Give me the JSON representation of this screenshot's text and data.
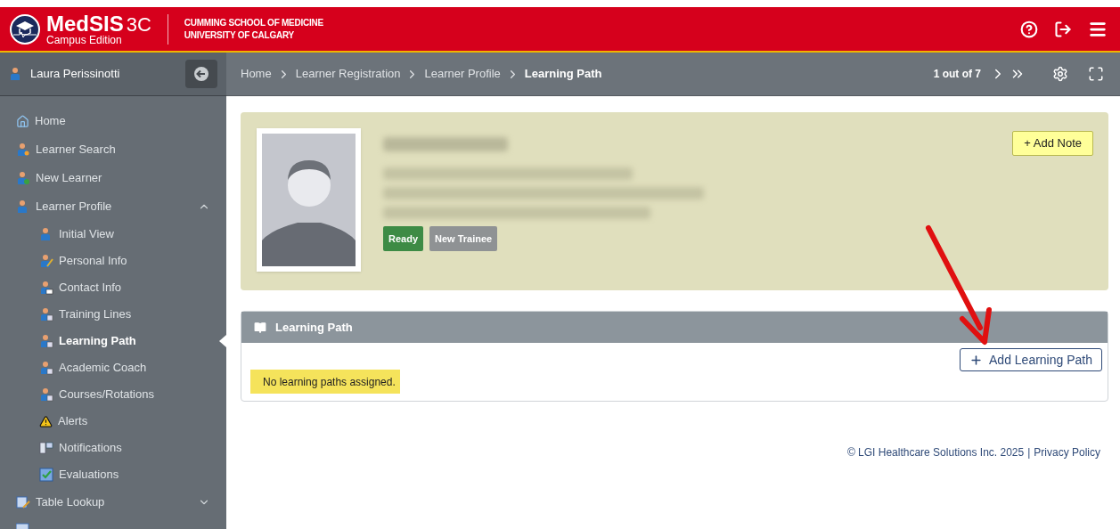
{
  "header": {
    "logo_title": "MedSIS",
    "logo_version": "3C",
    "logo_subtitle": "Campus Edition",
    "school_line_1": "CUMMING SCHOOL OF MEDICINE",
    "school_line_2": "UNIVERSITY OF CALGARY"
  },
  "user": {
    "name": "Laura Perissinotti"
  },
  "breadcrumb": [
    {
      "label": "Home",
      "current": false
    },
    {
      "label": "Learner Registration",
      "current": false
    },
    {
      "label": "Learner Profile",
      "current": false
    },
    {
      "label": "Learning Path",
      "current": true
    }
  ],
  "pager": {
    "text": "1 out of 7"
  },
  "sidebar": {
    "items": [
      {
        "label": "Home",
        "selected": false
      },
      {
        "label": "Learner Search",
        "selected": false
      },
      {
        "label": "New Learner",
        "selected": false
      },
      {
        "label": "Learner Profile",
        "selected": false,
        "expanded": true,
        "children": [
          {
            "label": "Initial View",
            "selected": false
          },
          {
            "label": "Personal Info",
            "selected": false
          },
          {
            "label": "Contact Info",
            "selected": false
          },
          {
            "label": "Training Lines",
            "selected": false
          },
          {
            "label": "Learning Path",
            "selected": true
          },
          {
            "label": "Academic Coach",
            "selected": false
          },
          {
            "label": "Courses/Rotations",
            "selected": false
          },
          {
            "label": "Alerts",
            "selected": false
          },
          {
            "label": "Notifications",
            "selected": false
          },
          {
            "label": "Evaluations",
            "selected": false
          }
        ]
      },
      {
        "label": "Table Lookup",
        "selected": false,
        "expanded": false
      }
    ]
  },
  "profile": {
    "badges": [
      {
        "label": "Ready",
        "color": "#3d8b45"
      },
      {
        "label": "New Trainee",
        "color": "#8f9294"
      }
    ],
    "add_note_button": "+ Add Note"
  },
  "learning_path": {
    "title": "Learning Path",
    "add_button": "Add Learning Path",
    "empty_message": "No learning paths assigned."
  },
  "footer": {
    "copyright": "© LGI Healthcare Solutions Inc. 2025",
    "separator": "|",
    "privacy_link": "Privacy Policy"
  }
}
